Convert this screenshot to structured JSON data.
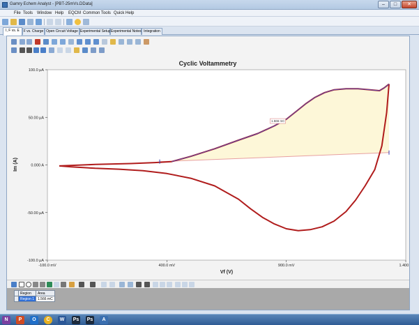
{
  "window": {
    "title": "Gamry Echem Analyst - [PBT-25mVs.DData]",
    "minimize_label": "–",
    "maximize_label": "□",
    "close_label": "✕"
  },
  "menu": [
    "File",
    "Tools",
    "Window",
    "Help",
    "EQCM",
    "Common Tools",
    "Quick Help"
  ],
  "tabs": [
    "I, F vs. E",
    "F vs. Charge",
    "Open Circuit Voltage",
    "Experimental Setup",
    "Experimental Notes",
    "Integration"
  ],
  "chart_data": {
    "type": "line",
    "title": "Cyclic Voltammetry",
    "xlabel": "Vf (V)",
    "ylabel": "Im (A)",
    "xlim": [
      -0.1,
      1.4
    ],
    "ylim": [
      -0.0001,
      0.0001
    ],
    "x_ticks": [
      "-100.0 mV",
      "400.0 mV",
      "900.0 mV",
      "1.400 V"
    ],
    "x_tick_values": [
      -0.1,
      0.4,
      0.9,
      1.4
    ],
    "y_ticks": [
      "100.0 µA",
      "50.00 µA",
      "0.000 A",
      "-50.00 µA",
      "-100.0 µA"
    ],
    "y_tick_values": [
      0.0001,
      5e-05,
      0,
      -5e-05,
      -0.0001
    ],
    "grid": false,
    "series": [
      {
        "color": "#b01c1c",
        "x": [
          -0.05,
          0.1,
          0.25,
          0.35,
          0.42,
          0.5,
          0.6,
          0.7,
          0.78,
          0.85,
          0.9,
          0.94,
          0.98,
          1.02,
          1.06,
          1.1,
          1.15,
          1.2,
          1.25,
          1.29,
          1.31,
          1.32,
          1.33
        ],
        "y": [
          -1e-06,
          5e-07,
          1.5e-06,
          2.5e-06,
          3.5e-06,
          9e-06,
          1.7e-05,
          2.6e-05,
          3.3e-05,
          4.1e-05,
          4.8e-05,
          5.6e-05,
          6.4e-05,
          7.1e-05,
          7.6e-05,
          7.9e-05,
          8e-05,
          8e-05,
          7.9e-05,
          7.8e-05,
          8.1e-05,
          8.3e-05,
          8.5e-05
        ]
      },
      {
        "color": "#b01c1c",
        "x": [
          1.33,
          1.32,
          1.3,
          1.27,
          1.23,
          1.19,
          1.15,
          1.1,
          1.05,
          1.0,
          0.95,
          0.9,
          0.85,
          0.8,
          0.75,
          0.7,
          0.6,
          0.5,
          0.4,
          0.3,
          0.2,
          0.1,
          0.0,
          -0.05
        ],
        "y": [
          8.5e-05,
          5.5e-05,
          2e-05,
          -5e-06,
          -2.2e-05,
          -3.7e-05,
          -4.9e-05,
          -5.9e-05,
          -6.5e-05,
          -6.8e-05,
          -6.9e-05,
          -6.7e-05,
          -6.2e-05,
          -5.5e-05,
          -4.6e-05,
          -3.6e-05,
          -2.2e-05,
          -1.4e-05,
          -9e-06,
          -6e-06,
          -4.5e-06,
          -3.5e-06,
          -2e-06,
          -1e-06
        ]
      }
    ],
    "integration_region": {
      "x_start": 0.37,
      "x_end": 1.33,
      "baseline_start": 3.5e-06,
      "baseline_end": 1.3e-05,
      "fill_color": "#fdf7d8",
      "baseline_color": "#e7a0a0",
      "trace_color": "#5a4ab0"
    },
    "annotation": "1.566 mC",
    "annotation_x": 0.85,
    "annotation_y": 4.5e-05
  },
  "regions": {
    "headers": [
      "Region",
      "Area"
    ],
    "rows": [
      [
        "Region 1",
        "1.566 mC"
      ]
    ]
  },
  "taskbar": [
    "N",
    "P",
    "O",
    "C",
    "W",
    "Ps",
    "Ps",
    "A"
  ]
}
